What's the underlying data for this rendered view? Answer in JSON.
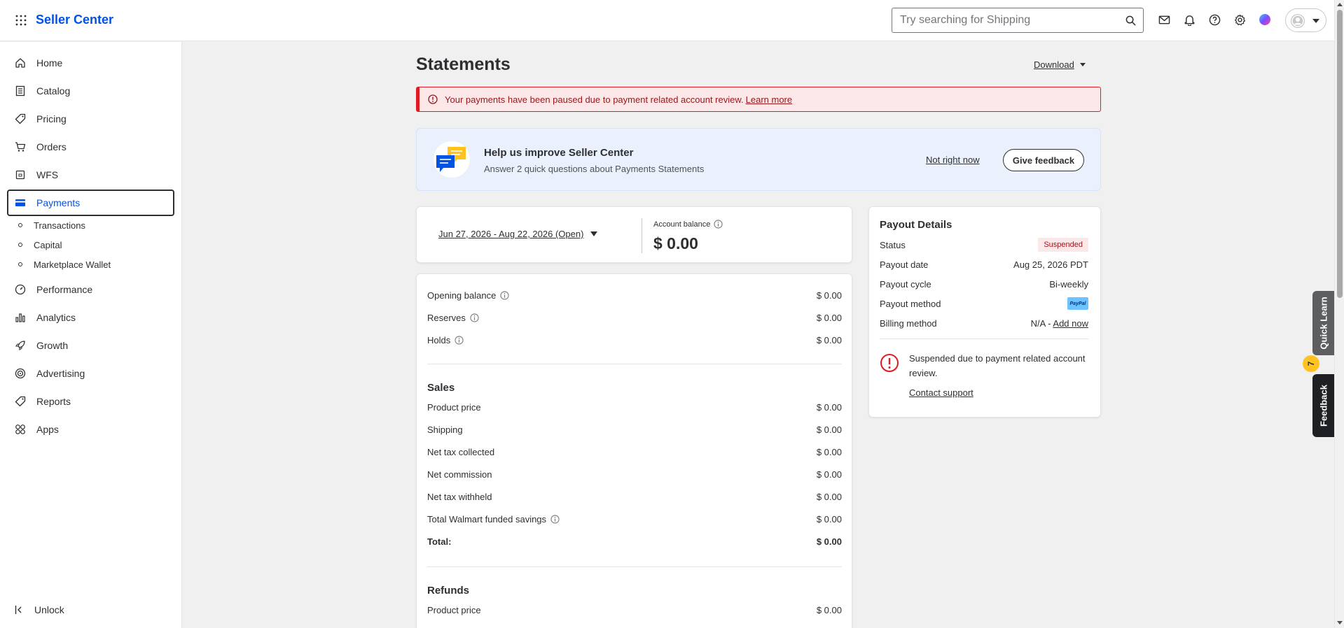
{
  "header": {
    "brand": "Seller Center",
    "search_placeholder": "Try searching for Shipping",
    "icons": [
      "apps-grid-icon",
      "mail-icon",
      "bell-icon",
      "help-icon",
      "gear-icon",
      "assistant-icon",
      "avatar-icon"
    ]
  },
  "sidebar": {
    "items": [
      {
        "label": "Home",
        "icon": "home-icon"
      },
      {
        "label": "Catalog",
        "icon": "catalog-icon"
      },
      {
        "label": "Pricing",
        "icon": "tag-icon"
      },
      {
        "label": "Orders",
        "icon": "cart-icon"
      },
      {
        "label": "WFS",
        "icon": "box-icon"
      },
      {
        "label": "Payments",
        "icon": "card-icon",
        "active": true
      },
      {
        "label": "Performance",
        "icon": "gauge-icon"
      },
      {
        "label": "Analytics",
        "icon": "bar-chart-icon"
      },
      {
        "label": "Growth",
        "icon": "rocket-icon"
      },
      {
        "label": "Advertising",
        "icon": "target-icon"
      },
      {
        "label": "Reports",
        "icon": "tag-icon"
      },
      {
        "label": "Apps",
        "icon": "apps-icon"
      }
    ],
    "sub_items": [
      "Transactions",
      "Capital",
      "Marketplace Wallet"
    ],
    "unlock_label": "Unlock"
  },
  "page": {
    "title": "Statements",
    "download_label": "Download"
  },
  "alert": {
    "text": "Your payments have been paused due to payment related account review.",
    "link": "Learn more"
  },
  "feedback": {
    "title": "Help us improve Seller Center",
    "subtitle": "Answer 2 quick questions about Payments Statements",
    "not_now": "Not right now",
    "give": "Give feedback"
  },
  "balance": {
    "period": "Jun 27, 2026 - Aug 22, 2026 (Open)",
    "label": "Account balance",
    "value": "$ 0.00"
  },
  "summary": {
    "top_rows": [
      {
        "label": "Opening balance",
        "value": "$ 0.00",
        "info": true
      },
      {
        "label": "Reserves",
        "value": "$ 0.00",
        "info": true
      },
      {
        "label": "Holds",
        "value": "$ 0.00",
        "info": true
      }
    ],
    "sales_title": "Sales",
    "sales_rows": [
      {
        "label": "Product price",
        "value": "$ 0.00"
      },
      {
        "label": "Shipping",
        "value": "$ 0.00"
      },
      {
        "label": "Net tax collected",
        "value": "$ 0.00"
      },
      {
        "label": "Net commission",
        "value": "$ 0.00"
      },
      {
        "label": "Net tax withheld",
        "value": "$ 0.00"
      },
      {
        "label": "Total Walmart funded savings",
        "value": "$ 0.00",
        "info": true
      }
    ],
    "sales_total": {
      "label": "Total:",
      "value": "$ 0.00"
    },
    "refunds_title": "Refunds",
    "refunds_rows": [
      {
        "label": "Product price",
        "value": "$ 0.00"
      }
    ]
  },
  "payout": {
    "title": "Payout Details",
    "status_label": "Status",
    "status_value": "Suspended",
    "date_label": "Payout date",
    "date_value": "Aug 25, 2026 PDT",
    "cycle_label": "Payout cycle",
    "cycle_value": "Bi-weekly",
    "method_label": "Payout method",
    "method_value": "PayPal",
    "billing_label": "Billing method",
    "billing_value": "N/A -",
    "billing_link": "Add now",
    "warning": "Suspended due to payment related account review.",
    "contact": "Contact support"
  },
  "side_tabs": {
    "quick_learn": "Quick Learn",
    "quick_learn_count": "7",
    "feedback": "Feedback"
  },
  "colors": {
    "brand_blue": "#0053e2",
    "alert_red": "#de1c24",
    "alert_bg": "#fce8e9"
  }
}
